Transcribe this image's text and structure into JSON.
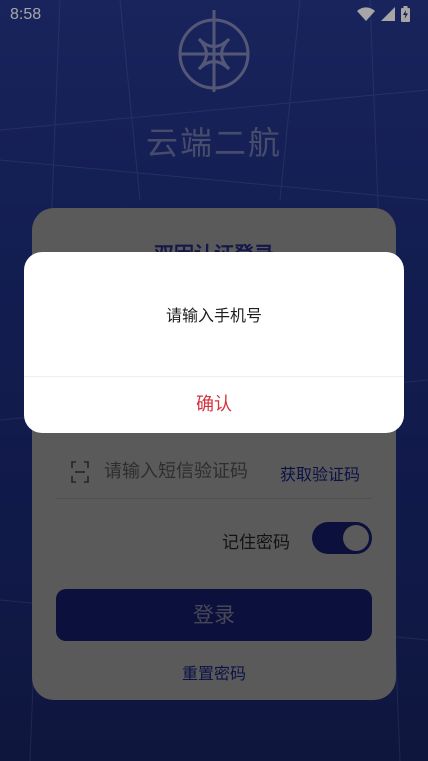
{
  "status_bar": {
    "time": "8:58"
  },
  "app": {
    "name": "云端二航"
  },
  "login_card": {
    "title": "双因认证登录",
    "sms_placeholder": "请输入短信验证码",
    "get_code_label": "获取验证码",
    "remember_label": "记住密码",
    "remember_enabled": true,
    "login_label": "登录",
    "reset_label": "重置密码"
  },
  "dialog": {
    "message": "请输入手机号",
    "confirm_label": "确认"
  },
  "colors": {
    "primary": "#121a5c",
    "dialog_confirm": "#d2333f"
  }
}
